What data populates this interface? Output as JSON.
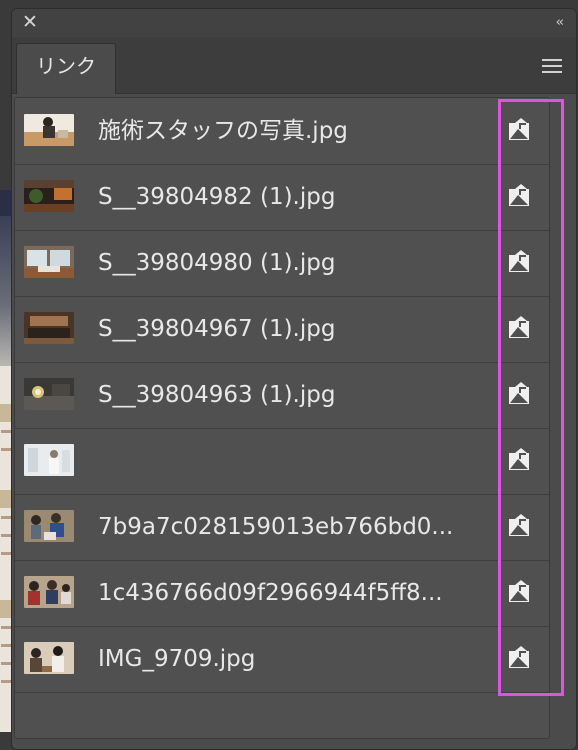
{
  "window": {
    "close_glyph": "✕",
    "collapse_glyph": "‹‹",
    "tab_label": "リンク"
  },
  "links": [
    {
      "name": "施術スタッフの写真.jpg",
      "thumb": "staff"
    },
    {
      "name": "S__39804982 (1).jpg",
      "thumb": "interior-warm"
    },
    {
      "name": "S__39804980 (1).jpg",
      "thumb": "interior-window"
    },
    {
      "name": "S__39804967 (1).jpg",
      "thumb": "interior-bed"
    },
    {
      "name": "S__39804963 (1).jpg",
      "thumb": "interior-sparkle"
    },
    {
      "name": "",
      "thumb": "white-clinic"
    },
    {
      "name": "7b9a7c028159013eb766bd0...",
      "thumb": "people-blue"
    },
    {
      "name": "1c436766d09f2966944f5ff8...",
      "thumb": "people-group"
    },
    {
      "name": "IMG_9709.jpg",
      "thumb": "people-seated"
    }
  ],
  "colors": {
    "panel": "#4b4b4b",
    "list": "#505050",
    "highlight": "#e052e0",
    "text": "#e8e8e8"
  }
}
